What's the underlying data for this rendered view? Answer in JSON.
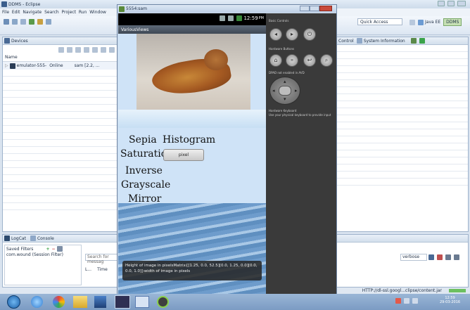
{
  "eclipse": {
    "title": "DDMS - Eclipse",
    "menu": [
      "File",
      "Edit",
      "Navigate",
      "Search",
      "Project",
      "Run",
      "Window"
    ],
    "quick_access": "Quick Access",
    "perspectives": [
      "Java EE",
      "DDMS"
    ],
    "devices_tab": "Devices",
    "devices_header": "Name",
    "device_row": {
      "name": "emulator-555-",
      "state": "Online",
      "app": "sam [2.2, ..."
    },
    "right_tabs": [
      "Control",
      "System Information"
    ],
    "logcat_tab": "LogCat",
    "console_tab": "Console",
    "saved_filters": "Saved Filters",
    "filter_item": "com.wound (Session Filter)",
    "search_placeholder": "Search for messag",
    "level_col": "L...",
    "time_col": "Time",
    "verbose": "verbose",
    "status_url": "HTTP://dl-ssl.googl...clipse/content.jar"
  },
  "emulator": {
    "title": "5554:sam",
    "clock": "12:59",
    "ampm": "PM",
    "app_title": "VariousViews",
    "options": [
      "Sepia",
      "Histogram",
      "Saturation",
      "Inverse",
      "Grayscale",
      "Mirror"
    ],
    "pixel_button": "pixel",
    "toast": "Height of image in pixelsMatrix{[1.25, 0.0, 52.5][0.0, 1.25, 0.0][0.0, 0.0, 1.0]}width of image in pixels",
    "basic_controls": "Basic Controls",
    "hardware_buttons": "Hardware Buttons",
    "dpad_label": "DPAD not enabled in AVD",
    "hw_keyboard": "Hardware Keyboard",
    "hw_keyboard_hint": "Use your physical keyboard to provide input"
  },
  "taskbar": {
    "clock": "12:59",
    "date": "29-03-2016"
  },
  "colors": {
    "taskbar": "#7b9bc3",
    "app_bar": "#3e4854",
    "skin": "#3a3a3a"
  }
}
